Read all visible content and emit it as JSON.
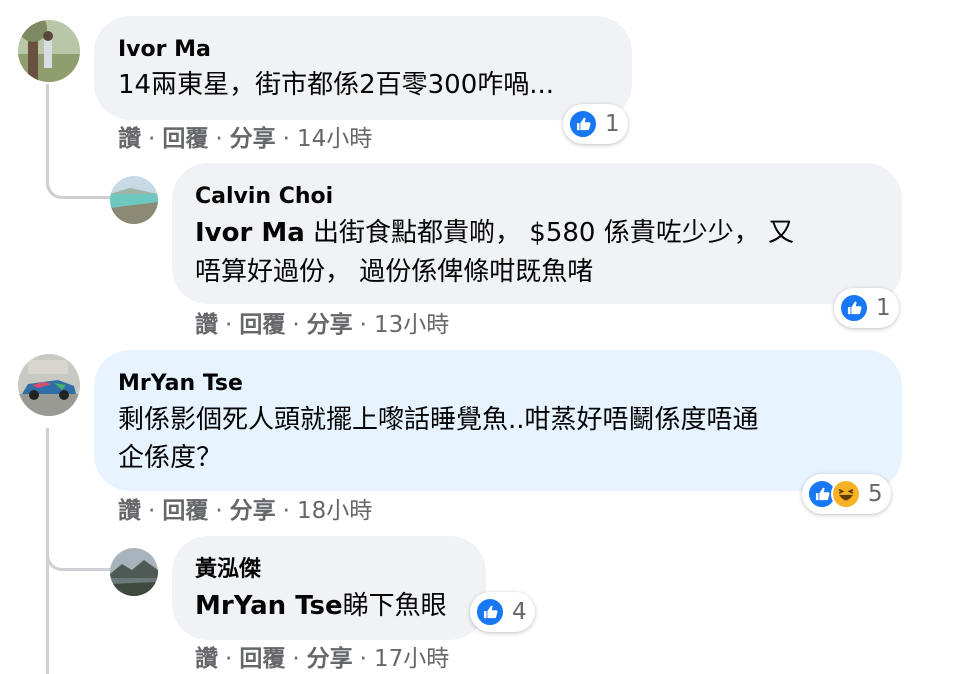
{
  "actions": {
    "like": "讚",
    "reply": "回覆",
    "share": "分享",
    "sep": "·"
  },
  "comments": [
    {
      "author": "Ivor Ma",
      "text": "14兩東星，街市都係2百零300咋喎...",
      "reactions": {
        "icons": [
          "like-icon"
        ],
        "count": "1"
      },
      "time": "14小時",
      "avatar": "avatar-tree-photo"
    },
    {
      "author": "Calvin Choi",
      "mention": "Ivor Ma",
      "text_line1": " 出街食點都貴啲， $580 係貴咗少少， 又",
      "text_line2": "唔算好過份， 過份係俾條咁既魚啫",
      "reactions": {
        "icons": [
          "like-icon"
        ],
        "count": "1"
      },
      "time": "13小時",
      "avatar": "avatar-lake-photo"
    },
    {
      "author": "MrYan Tse",
      "text_line1": "剩係影個死人頭就擺上嚟話睡覺魚..咁蒸好唔鬭係度唔通",
      "text_line2": "企係度？",
      "reactions": {
        "icons": [
          "like-icon",
          "haha-icon"
        ],
        "count": "5"
      },
      "time": "18小時",
      "avatar": "avatar-car-photo"
    },
    {
      "author": "黃泓傑",
      "mention": "MrYan Tse",
      "text": "睇下魚眼",
      "reactions": {
        "icons": [
          "like-icon"
        ],
        "count": "4"
      },
      "time": "17小時",
      "avatar": "avatar-landscape-photo"
    }
  ],
  "colors": {
    "like_blue": "#1877f2",
    "haha_yellow": "#f7b125",
    "bubble_grey": "#f0f2f5",
    "bubble_blue": "#e7f3ff",
    "meta_grey": "#65676b"
  }
}
